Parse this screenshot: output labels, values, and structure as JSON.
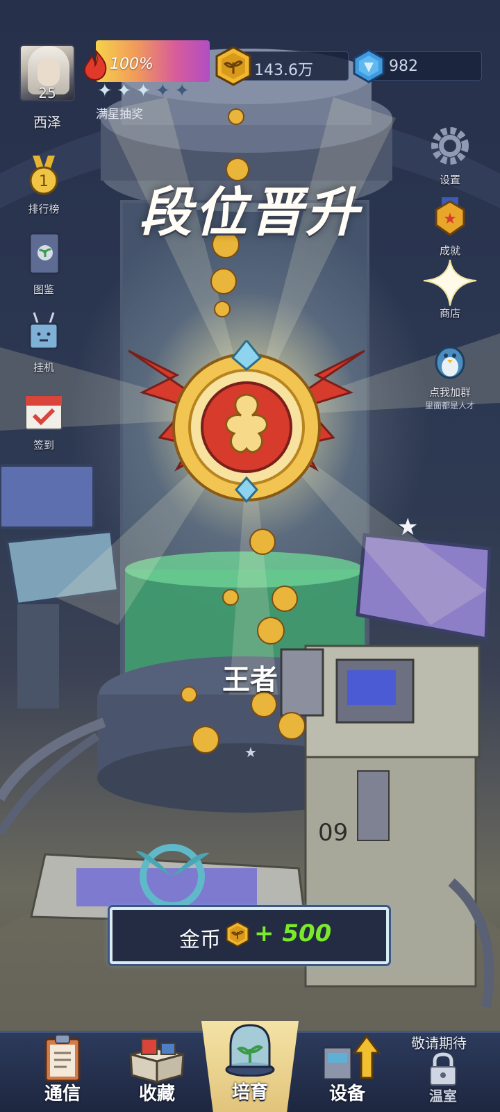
{
  "player": {
    "level": "25",
    "name": "西泽"
  },
  "energy": {
    "percent_text": "100%",
    "stars_filled": 3,
    "stars_total": 5,
    "lottery_label": "满星抽奖"
  },
  "currency": {
    "gold": "143.6万",
    "gems": "982"
  },
  "left_menu": [
    {
      "label": "排行榜",
      "icon": "medal-icon"
    },
    {
      "label": "图鉴",
      "icon": "book-icon"
    },
    {
      "label": "挂机",
      "icon": "robot-icon"
    },
    {
      "label": "签到",
      "icon": "calendar-icon"
    }
  ],
  "right_menu": [
    {
      "label": "设置",
      "icon": "gear-icon"
    },
    {
      "label": "成就",
      "icon": "badge-icon"
    },
    {
      "label": "商店",
      "icon": "star-icon"
    },
    {
      "label": "点我加群",
      "sublabel": "里面都是人才",
      "icon": "penguin-icon"
    }
  ],
  "promotion": {
    "title": "段位晋升",
    "rank": "王者"
  },
  "reward": {
    "label": "金币",
    "value": "+ 500",
    "value_color": "#7bea2a"
  },
  "bottom_nav": {
    "tabs": [
      {
        "label": "通信",
        "icon": "clipboard-icon"
      },
      {
        "label": "收藏",
        "icon": "box-icon"
      },
      {
        "label": "培育",
        "icon": "dome-icon",
        "active": true
      },
      {
        "label": "设备",
        "icon": "machine-icon"
      },
      {
        "label": "温室",
        "icon": "lock-icon",
        "locked": true
      }
    ],
    "coming_soon": "敬请期待"
  },
  "colors": {
    "gold": "#f0b830",
    "accent_active": "#f4e3a5",
    "badge_red": "#d63b2c"
  }
}
